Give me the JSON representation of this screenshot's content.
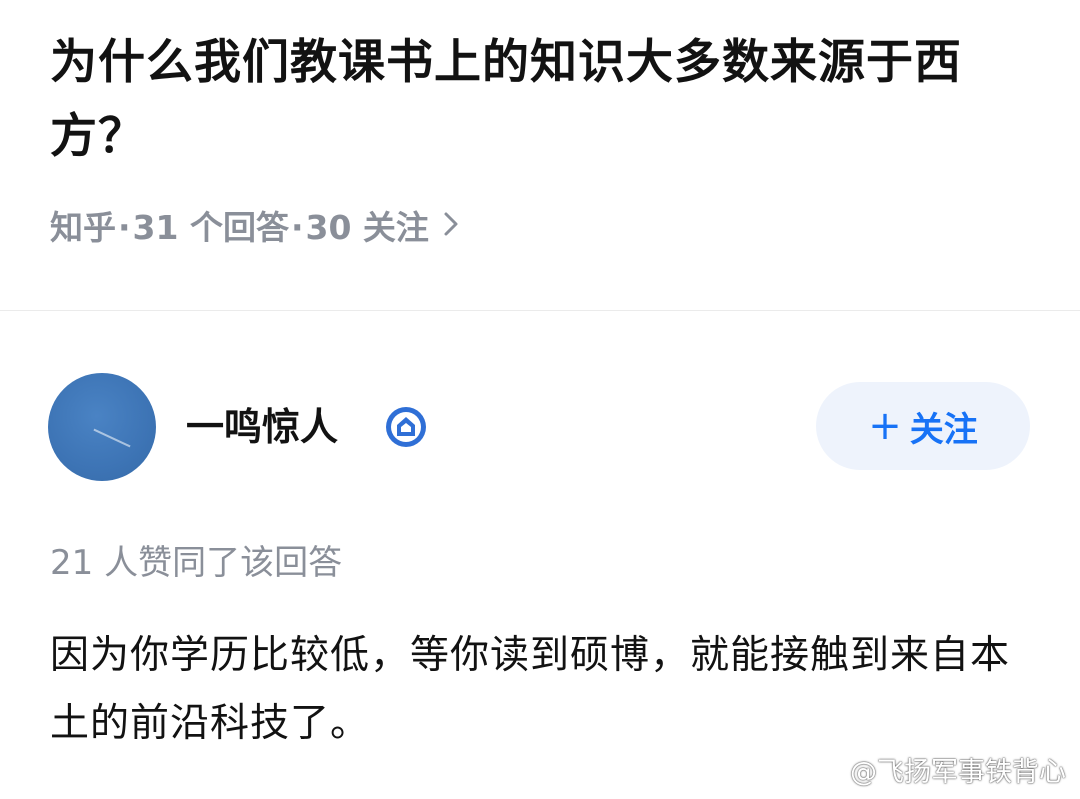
{
  "question": {
    "title": "为什么我们教课书上的知识大多数来源于西方？",
    "source": "知乎",
    "answers": "31 个回答",
    "followers": "30 关注",
    "separator": "·"
  },
  "author": {
    "name": "一鸣惊人",
    "follow_icon": "+",
    "follow_label": "关注"
  },
  "answer": {
    "likes_text": "21 人赞同了该回答",
    "content": "因为你学历比较低，等你读到硕博，就能接触到来自本土的前沿科技了。"
  },
  "watermark": {
    "text": "@飞扬军事铁背心"
  },
  "colors": {
    "accent": "#1772f6",
    "follow_button_bg": "#eef3fc",
    "muted_text": "#8a8f99",
    "avatar_blue": "#3d74b5"
  },
  "icons": {
    "chevron": "chevron-right-icon",
    "verify": "verified-badge-icon",
    "weibo": "weibo-logo-icon"
  }
}
